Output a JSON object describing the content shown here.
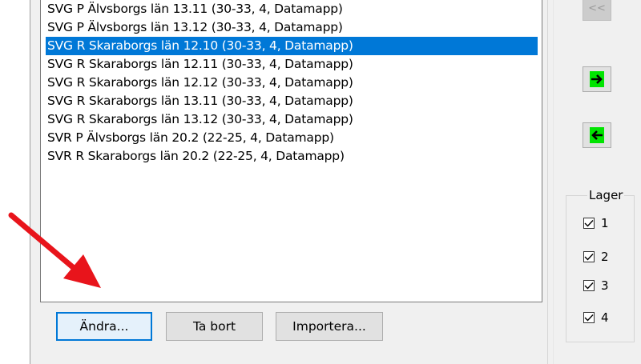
{
  "layer_list": {
    "items": [
      {
        "label": "SVG P Älvsborgs län 13.11 (30-33, 4, Datamapp)",
        "selected": false
      },
      {
        "label": "SVG P Älvsborgs län 13.12 (30-33, 4, Datamapp)",
        "selected": false
      },
      {
        "label": "SVG R Skaraborgs län 12.10 (30-33, 4, Datamapp)",
        "selected": true
      },
      {
        "label": "SVG R Skaraborgs län 12.11 (30-33, 4, Datamapp)",
        "selected": false
      },
      {
        "label": "SVG R Skaraborgs län 12.12 (30-33, 4, Datamapp)",
        "selected": false
      },
      {
        "label": "SVG R Skaraborgs län 13.11 (30-33, 4, Datamapp)",
        "selected": false
      },
      {
        "label": "SVG R Skaraborgs län 13.12 (30-33, 4, Datamapp)",
        "selected": false
      },
      {
        "label": "SVR P Älvsborgs län 20.2 (22-25, 4, Datamapp)",
        "selected": false
      },
      {
        "label": "SVR R Skaraborgs län 20.2 (22-25, 4, Datamapp)",
        "selected": false
      }
    ]
  },
  "buttons": {
    "edit": "Ändra...",
    "remove": "Ta bort",
    "import": "Importera..."
  },
  "side_buttons": {
    "collapse_label": "<<",
    "move_right_icon": "arrow-right-icon",
    "move_left_icon": "arrow-left-icon"
  },
  "layers_group": {
    "title": "Lager",
    "checkboxes": [
      {
        "label": "1",
        "checked": true
      },
      {
        "label": "2",
        "checked": true
      },
      {
        "label": "3",
        "checked": true
      },
      {
        "label": "4",
        "checked": true
      }
    ]
  },
  "colors": {
    "selection": "#0078d7",
    "annotation_arrow": "#e8141b",
    "green_icon": "#00e400"
  }
}
